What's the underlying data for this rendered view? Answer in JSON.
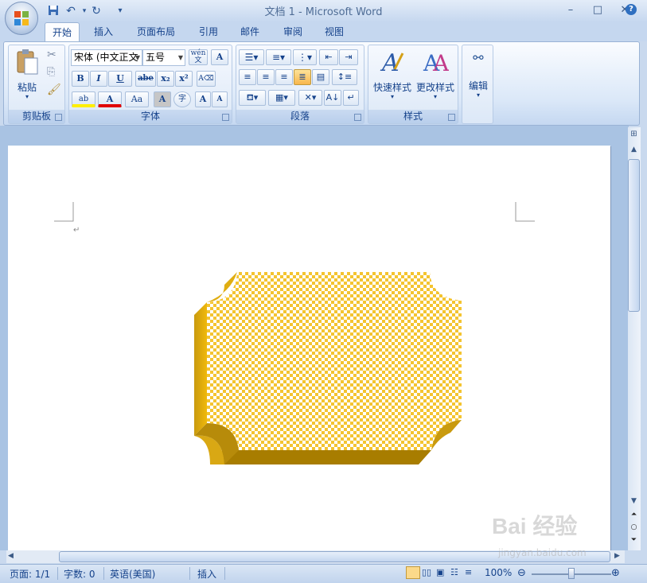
{
  "window": {
    "title": "文档 1 - Microsoft Word"
  },
  "quick_access": {
    "save": "save-icon",
    "undo": "undo-icon",
    "redo": "redo-icon",
    "customize": "▾"
  },
  "window_buttons": {
    "minimize": "–",
    "maximize": "□",
    "close": "✕"
  },
  "tabs": [
    {
      "label": "开始",
      "active": true
    },
    {
      "label": "插入"
    },
    {
      "label": "页面布局"
    },
    {
      "label": "引用"
    },
    {
      "label": "邮件"
    },
    {
      "label": "审阅"
    },
    {
      "label": "视图"
    }
  ],
  "ribbon": {
    "clipboard": {
      "title": "剪贴板",
      "paste": "粘贴"
    },
    "font": {
      "title": "字体",
      "font_name": "宋体 (中文正文",
      "font_size": "五号",
      "wen_button": "wén\n文",
      "char_border": "A",
      "bold": "B",
      "italic": "I",
      "underline": "U",
      "strike": "abe",
      "subscript": "x₂",
      "superscript": "x²",
      "highlight": "ab",
      "font_color": "A",
      "change_case": "Aa",
      "char_shading": "A",
      "enclose": "字",
      "grow": "A",
      "shrink": "A"
    },
    "paragraph": {
      "title": "段落"
    },
    "styles": {
      "title": "样式",
      "quick_styles": "快速样式",
      "change_styles": "更改样式"
    },
    "editing": {
      "label": "编辑"
    }
  },
  "document": {
    "paragraph_mark": "↵",
    "shape_fill": "#f4c430",
    "shape_side": "#d4a017",
    "shape_dark": "#a67c00"
  },
  "statusbar": {
    "page": "页面: 1/1",
    "words": "字数: 0",
    "language": "英语(美国)",
    "mode": "插入",
    "zoom": "100%",
    "zoom_level": 100
  },
  "watermark": {
    "text": "Bai 经验",
    "sub": "jingyan.baidu.com"
  },
  "colors": {
    "accent": "#15428b",
    "ribbon_bg": "#dbe8f8"
  }
}
